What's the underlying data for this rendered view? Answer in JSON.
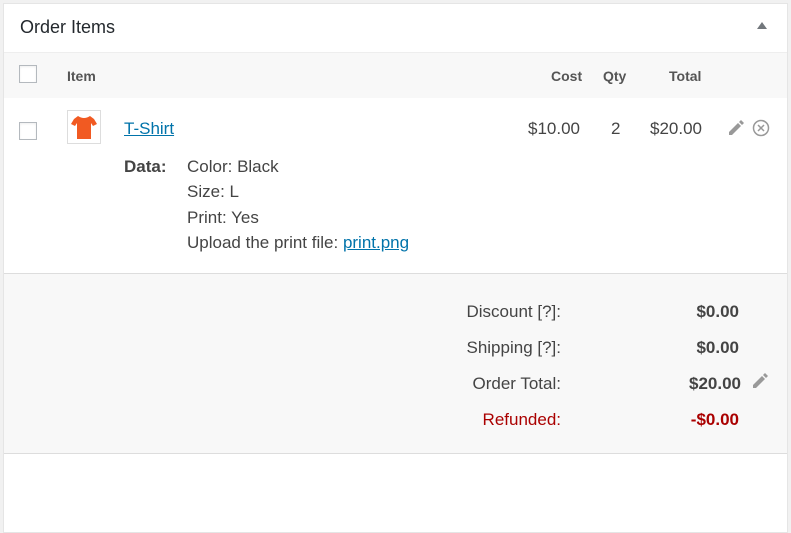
{
  "panel": {
    "title": "Order Items"
  },
  "columns": {
    "item": "Item",
    "cost": "Cost",
    "qty": "Qty",
    "total": "Total"
  },
  "line_item": {
    "name": "T-Shirt",
    "cost": "$10.00",
    "qty": "2",
    "total": "$20.00",
    "thumb_color": "#f15a22",
    "meta_label": "Data:",
    "meta": {
      "color": "Color: Black",
      "size": "Size: L",
      "print": "Print: Yes",
      "upload_label": "Upload the print file:",
      "upload_link": "print.png"
    }
  },
  "totals": {
    "discount_label": "Discount [?]:",
    "discount_value": "$0.00",
    "shipping_label": "Shipping [?]:",
    "shipping_value": "$0.00",
    "order_total_label": "Order Total:",
    "order_total_value": "$20.00",
    "refunded_label": "Refunded:",
    "refunded_value": "-$0.00"
  },
  "colors": {
    "link": "#0073aa",
    "refund": "#aa0000"
  }
}
